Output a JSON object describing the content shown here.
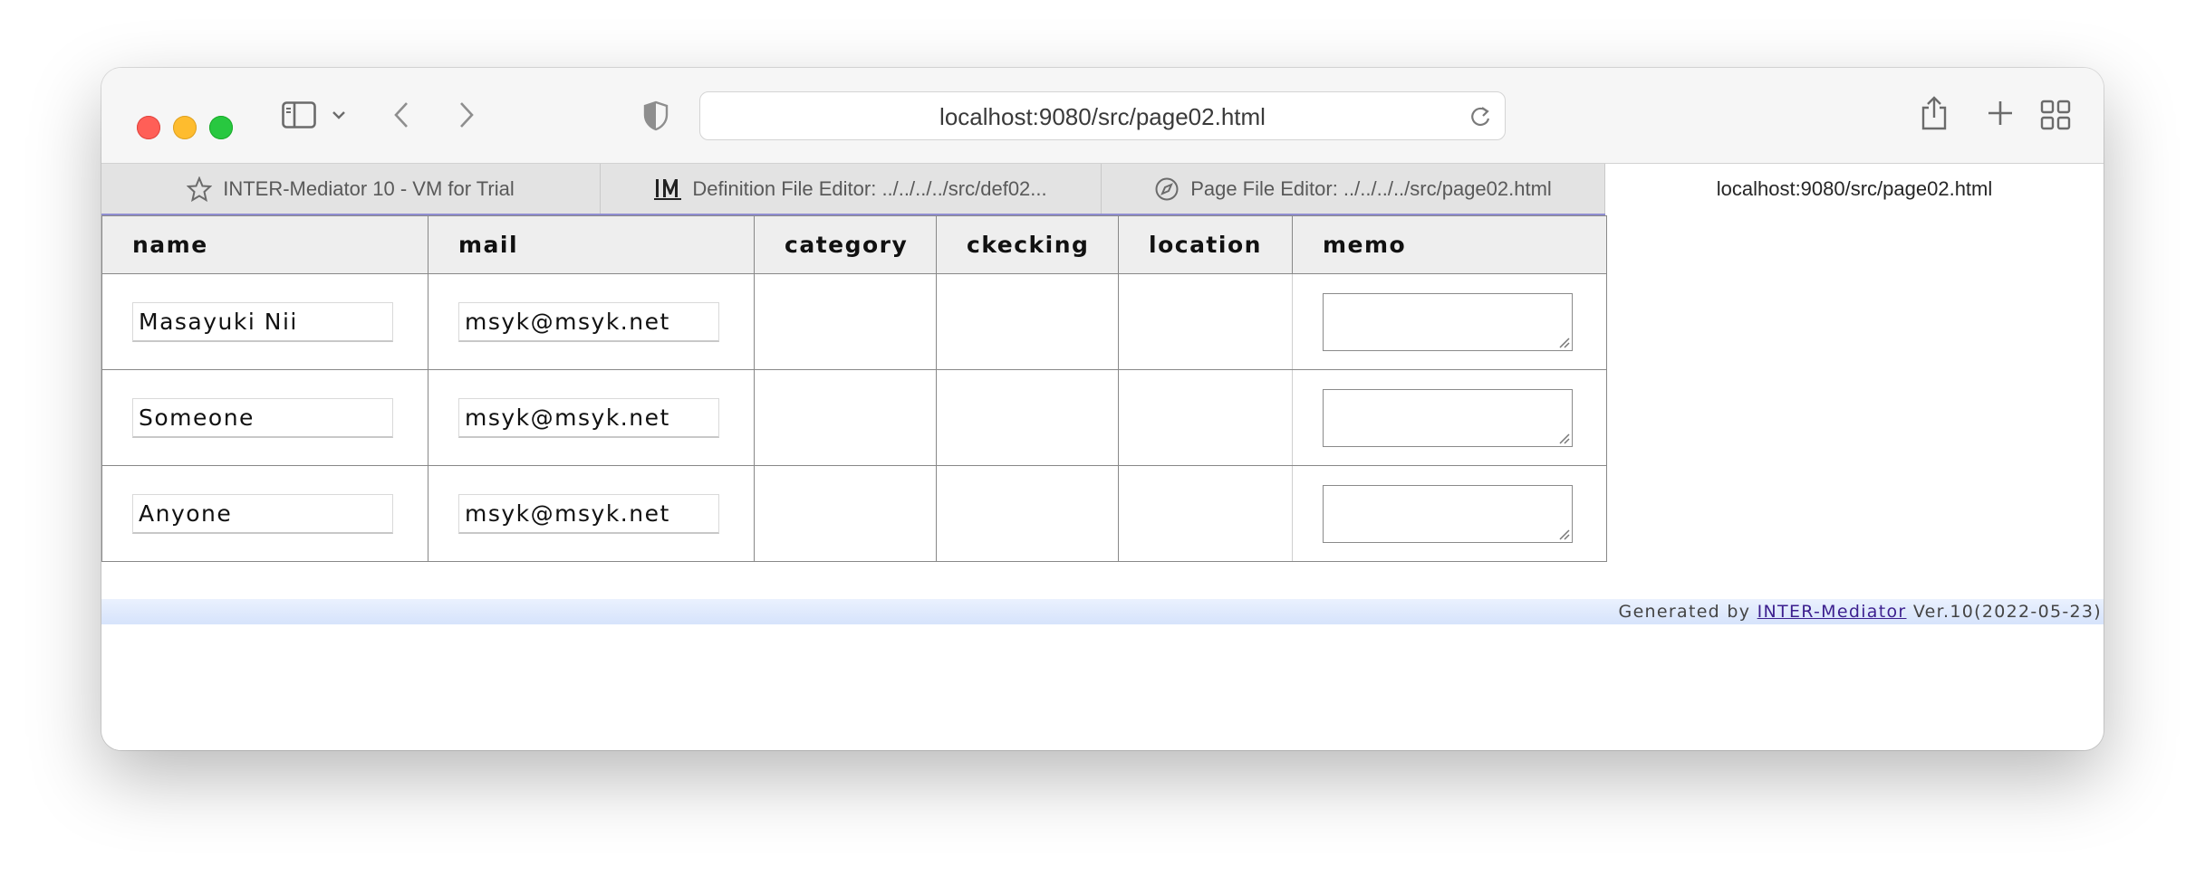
{
  "browser": {
    "url": "localhost:9080/src/page02.html",
    "tabs": [
      {
        "label": "INTER-Mediator 10 - VM for Trial",
        "icon": "star-icon"
      },
      {
        "label": "Definition File Editor: ../../../../src/def02...",
        "icon": "intermediator-logo-icon"
      },
      {
        "label": "Page File Editor: ../../../../src/page02.html",
        "icon": "compass-icon"
      },
      {
        "label": "localhost:9080/src/page02.html",
        "icon": ""
      }
    ]
  },
  "table": {
    "headers": [
      "name",
      "mail",
      "category",
      "ckecking",
      "location",
      "memo"
    ],
    "rows": [
      {
        "name": "Masayuki Nii",
        "mail": "msyk@msyk.net",
        "category": "",
        "checking": "",
        "location": "",
        "memo": ""
      },
      {
        "name": "Someone",
        "mail": "msyk@msyk.net",
        "category": "",
        "checking": "",
        "location": "",
        "memo": ""
      },
      {
        "name": "Anyone",
        "mail": "msyk@msyk.net",
        "category": "",
        "checking": "",
        "location": "",
        "memo": ""
      }
    ]
  },
  "footer": {
    "generated_by": "Generated by",
    "link_text": "INTER-Mediator",
    "version": "Ver.10(2022-05-23)"
  },
  "colors": {
    "close": "#ff5f57",
    "minimize": "#febc2e",
    "maximize": "#28c840",
    "footer_band": "#d6e3fb",
    "link": "#3c1f8e"
  }
}
